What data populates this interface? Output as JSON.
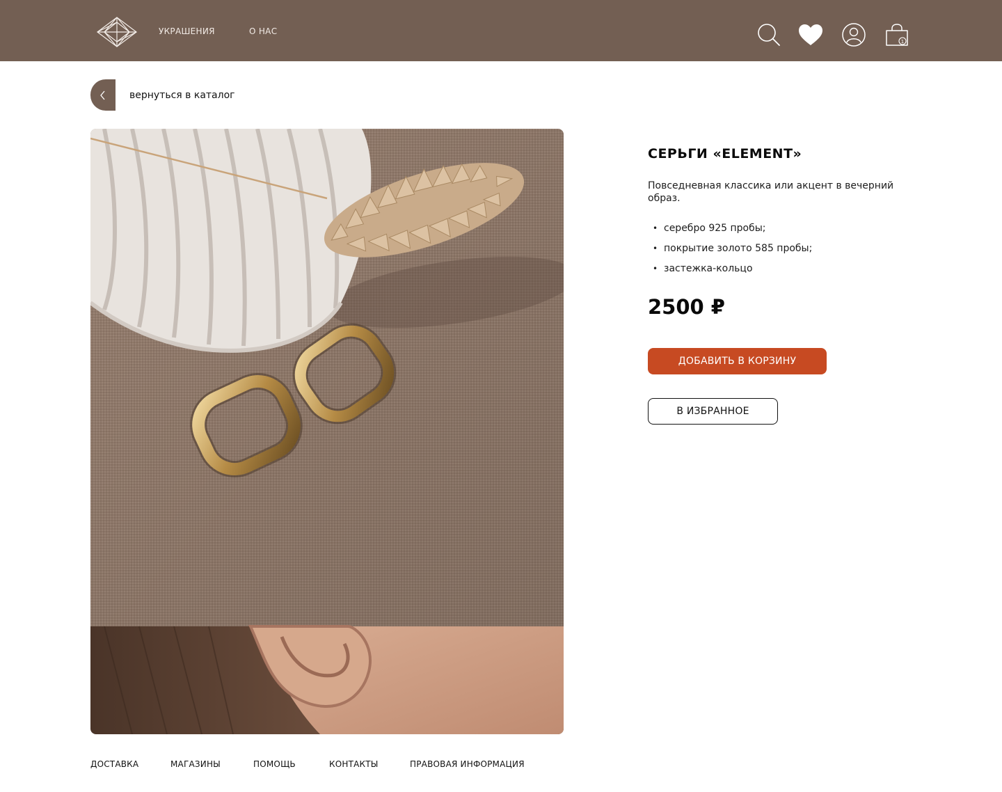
{
  "header": {
    "logo_icon": "diamond-logo",
    "nav": [
      {
        "label": "УКРАШЕНИЯ"
      },
      {
        "label": "О НАС"
      }
    ],
    "icons": [
      "search-icon",
      "heart-icon",
      "user-icon",
      "cart-icon"
    ],
    "cart_count": "1",
    "bg_color": "#735f53"
  },
  "back": {
    "icon": "chevron-left-icon",
    "label": "вернуться в каталог"
  },
  "product": {
    "title": "СЕРЬГИ «ELEMENT»",
    "description": "Повседневная классика или акцент в вечерний образ.",
    "features": [
      "серебро 925 пробы;",
      "покрытие золото 585 пробы;",
      "застежка-кольцо"
    ],
    "bullet": "•",
    "price": "2500 ₽",
    "add_to_cart_label": "ДОБАВИТЬ В КОРЗИНУ",
    "favorite_label": "В ИЗБРАННОЕ",
    "accent_color": "#c74a22"
  },
  "footer": {
    "links": [
      {
        "label": "ДОСТАВКА"
      },
      {
        "label": "МАГАЗИНЫ"
      },
      {
        "label": "ПОМОЩЬ"
      },
      {
        "label": "КОНТАКТЫ"
      },
      {
        "label": "ПРАВОВАЯ ИНФОРМАЦИЯ"
      }
    ]
  }
}
